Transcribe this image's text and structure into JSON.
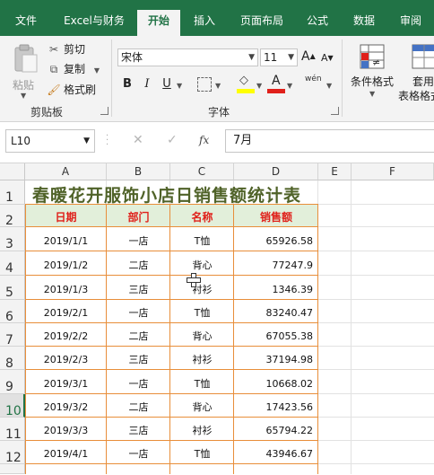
{
  "ribbon_tabs": [
    "文件",
    "Excel与财务",
    "开始",
    "插入",
    "页面布局",
    "公式",
    "数据",
    "审阅"
  ],
  "active_tab_index": 2,
  "clipboard": {
    "paste_label": "粘贴",
    "cut_label": "剪切",
    "copy_label": "复制",
    "format_painter_label": "格式刷",
    "group_label": "剪贴板"
  },
  "font": {
    "font_name": "宋体",
    "font_size": "11",
    "bold": "B",
    "italic": "I",
    "underline": "U",
    "grow": "A",
    "shrink": "A",
    "phonetic": "wén",
    "group_label": "字体",
    "fill_color": "#ffff00",
    "font_color": "#e0201a"
  },
  "styles": {
    "conditional_label": "条件格式",
    "table_label_1": "套用",
    "table_label_2": "表格格式"
  },
  "formula_bar": {
    "name_box": "L10",
    "fx": "fx",
    "cancel": "✕",
    "enter": "✓",
    "content": "7月"
  },
  "columns": [
    "A",
    "B",
    "C",
    "D",
    "E",
    "F"
  ],
  "rows": [
    "1",
    "2",
    "3",
    "4",
    "5",
    "6",
    "7",
    "8",
    "9",
    "10",
    "11",
    "12"
  ],
  "selected_row": "10",
  "sheet": {
    "title": "春暖花开服饰小店日销售额统计表",
    "headers": [
      "日期",
      "部门",
      "名称",
      "销售额"
    ],
    "data": [
      [
        "2019/1/1",
        "一店",
        "T恤",
        "65926.58"
      ],
      [
        "2019/1/2",
        "二店",
        "背心",
        "77247.9"
      ],
      [
        "2019/1/3",
        "三店",
        "衬衫",
        "1346.39"
      ],
      [
        "2019/2/1",
        "一店",
        "T恤",
        "83240.47"
      ],
      [
        "2019/2/2",
        "二店",
        "背心",
        "67055.38"
      ],
      [
        "2019/2/3",
        "三店",
        "衬衫",
        "37194.98"
      ],
      [
        "2019/3/1",
        "一店",
        "T恤",
        "10668.02"
      ],
      [
        "2019/3/2",
        "二店",
        "背心",
        "17423.56"
      ],
      [
        "2019/3/3",
        "三店",
        "衬衫",
        "65794.22"
      ],
      [
        "2019/4/1",
        "一店",
        "T恤",
        "43946.67"
      ]
    ]
  }
}
